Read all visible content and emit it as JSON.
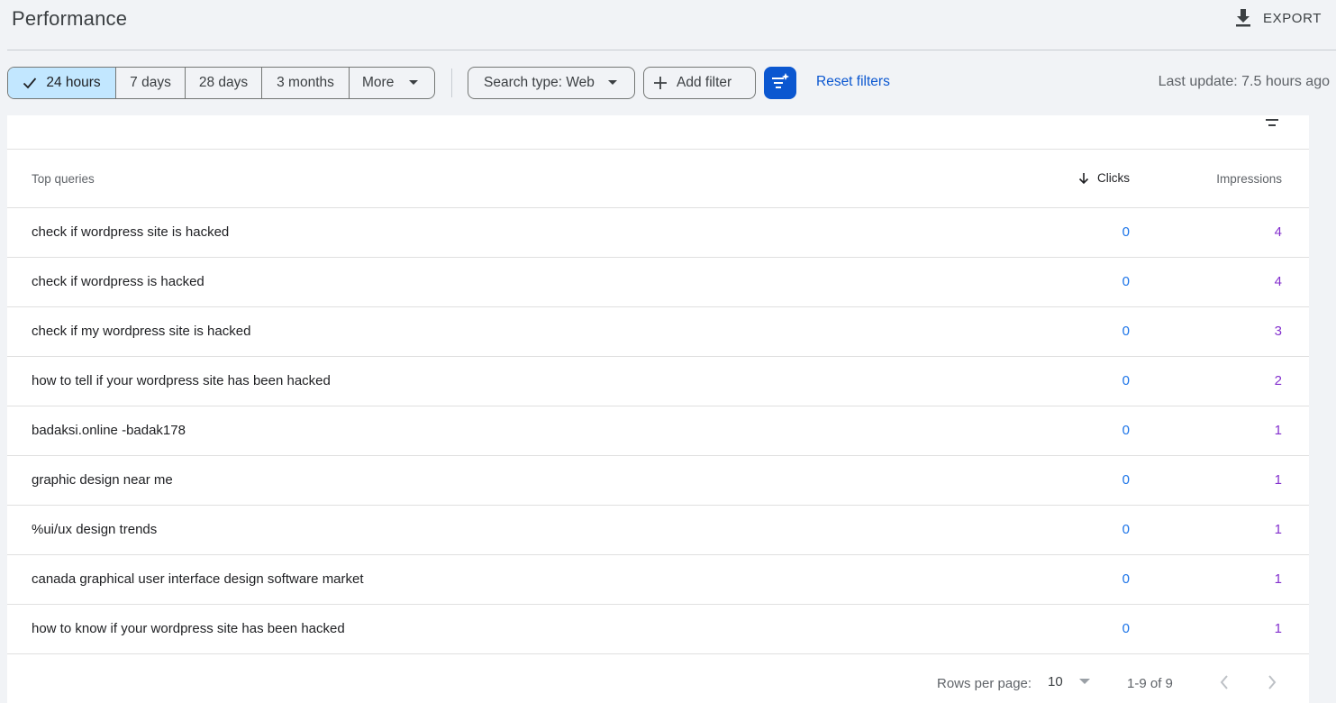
{
  "header": {
    "title": "Performance",
    "export_label": "EXPORT",
    "export_icon": "download-icon"
  },
  "date_range": {
    "options": [
      "24 hours",
      "7 days",
      "28 days",
      "3 months",
      "More"
    ],
    "selected": "24 hours"
  },
  "filters": {
    "search_type_label": "Search type: Web",
    "add_filter_label": "Add filter",
    "ai_filter_icon": "ai-filter-icon",
    "reset_label": "Reset filters",
    "last_update": "Last update: 7.5 hours ago"
  },
  "table": {
    "columns": {
      "query": "Top queries",
      "clicks": "Clicks",
      "impressions": "Impressions"
    },
    "sort": {
      "column": "clicks",
      "direction": "descending"
    },
    "rows": [
      {
        "query": "check if wordpress site is hacked",
        "clicks": "0",
        "impressions": "4"
      },
      {
        "query": "check if wordpress is hacked",
        "clicks": "0",
        "impressions": "4"
      },
      {
        "query": "check if my wordpress site is hacked",
        "clicks": "0",
        "impressions": "3"
      },
      {
        "query": "how to tell if your wordpress site has been hacked",
        "clicks": "0",
        "impressions": "2"
      },
      {
        "query": "badaksi.online -badak178",
        "clicks": "0",
        "impressions": "1"
      },
      {
        "query": "graphic design near me",
        "clicks": "0",
        "impressions": "1"
      },
      {
        "query": "%ui/ux design trends",
        "clicks": "0",
        "impressions": "1"
      },
      {
        "query": "canada graphical user interface design software market",
        "clicks": "0",
        "impressions": "1"
      },
      {
        "query": "how to know if your wordpress site has been hacked",
        "clicks": "0",
        "impressions": "1"
      }
    ]
  },
  "pagination": {
    "rows_per_page_label": "Rows per page:",
    "rows_per_page": "10",
    "range": "1-9 of 9"
  },
  "colors": {
    "accent": "#0b57d0",
    "selected_chip": "#c2e7ff",
    "clicks": "#1a73e8",
    "impressions": "#8430ce"
  }
}
